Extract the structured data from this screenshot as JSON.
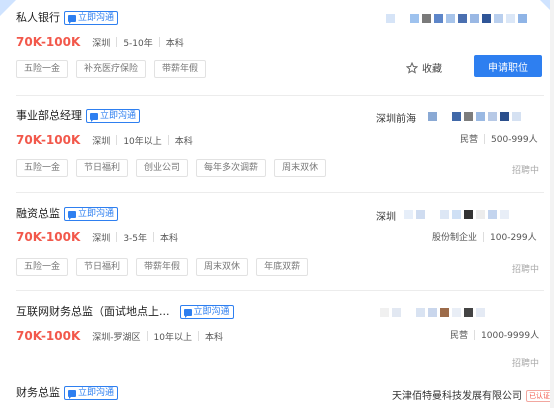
{
  "chat_label": "立即沟通",
  "apply_label": "申请职位",
  "favorite_label": "收藏",
  "status_label": "招聘中",
  "jobs": [
    {
      "title": "私人银行",
      "salary": "70K-100K",
      "location": "深圳",
      "experience": "5-10年",
      "education": "本科",
      "tags": [
        "五险一金",
        "补充医疗保险",
        "带薪年假"
      ],
      "company_type": "",
      "company_size": ""
    },
    {
      "title": "事业部总经理",
      "salary": "70K-100K",
      "location": "深圳",
      "experience": "10年以上",
      "education": "本科",
      "tags": [
        "五险一金",
        "节日福利",
        "创业公司",
        "每年多次调薪",
        "周末双休"
      ],
      "company_prefix": "深圳前海",
      "company_type": "民营",
      "company_size": "500-999人"
    },
    {
      "title": "融资总监",
      "salary": "70K-100K",
      "location": "深圳",
      "experience": "3-5年",
      "education": "本科",
      "tags": [
        "五险一金",
        "节日福利",
        "带薪年假",
        "周末双休",
        "年底双薪"
      ],
      "company_prefix": "深圳",
      "company_type": "股份制企业",
      "company_size": "100-299人"
    },
    {
      "title": "互联网财务总监（面试地点上...",
      "salary": "70K-100K",
      "location": "深圳-罗湖区",
      "experience": "10年以上",
      "education": "本科",
      "tags": [],
      "company_type": "民营",
      "company_size": "1000-9999人"
    },
    {
      "title": "财务总监",
      "company_name": "天津佰特曼科技发展有限公司",
      "company_badge": "已认证"
    }
  ],
  "colors": {
    "accent": "#2e7ff0",
    "salary": "#f2584b"
  }
}
